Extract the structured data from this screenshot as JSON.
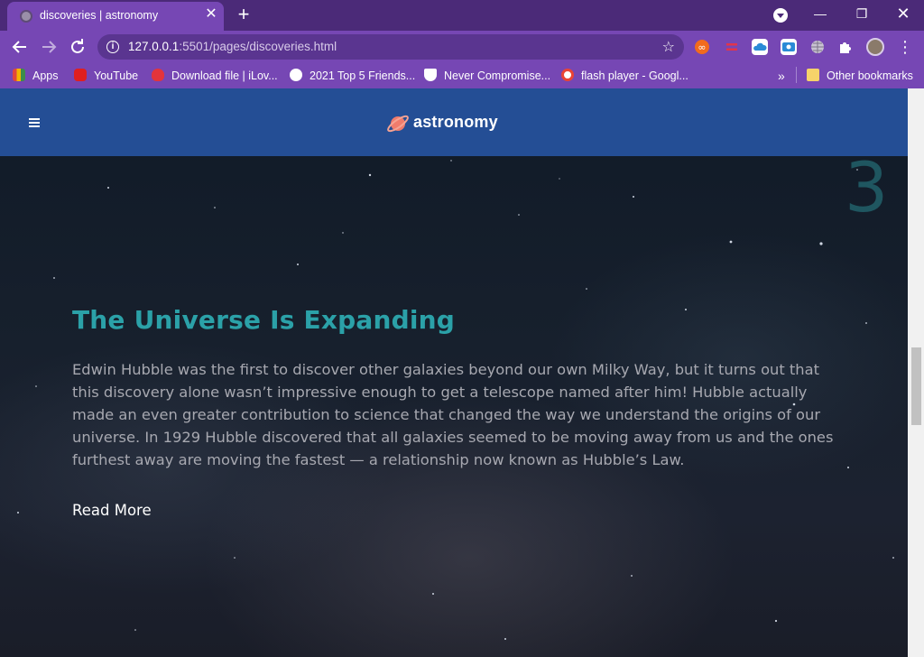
{
  "browser": {
    "tab_title": "discoveries | astronomy",
    "tab_close": "✕",
    "new_tab": "+",
    "url_host": "127.0.0.1",
    "url_path": ":5501/pages/discoveries.html",
    "window_controls": {
      "minimize": "—",
      "maximize": "❐",
      "close": "✕"
    }
  },
  "bookmarks": [
    {
      "label": "Apps",
      "icon": "apps-grid-icon",
      "color": "#e2463b"
    },
    {
      "label": "YouTube",
      "icon": "youtube-icon",
      "color": "#e01f1f"
    },
    {
      "label": "Download file | iLov...",
      "icon": "heart-icon",
      "color": "#e3343b"
    },
    {
      "label": "2021 Top 5 Friends...",
      "icon": "globe-icon",
      "color": "#ffffff"
    },
    {
      "label": "Never Compromise...",
      "icon": "shield-icon",
      "color": "#ffffff"
    },
    {
      "label": "flash player - Googl...",
      "icon": "google-icon",
      "color": "#ffffff"
    }
  ],
  "bookmarks_overflow": "»",
  "other_bookmarks": "Other bookmarks",
  "site": {
    "logo_text": "astronomy",
    "slide_number": "3",
    "title": "The Universe Is Expanding",
    "body": "Edwin Hubble was the first to discover other galaxies beyond our own Milky Way, but it turns out that this discovery alone wasn’t impressive enough to get a telescope named after him! Hubble actually made an even greater contribution to science that changed the way we understand the origins of our universe. In 1929 Hubble discovered that all galaxies seemed to be moving away from us and the ones furthest away are moving the fastest — a relationship now known as Hubble’s Law.",
    "read_more": "Read More"
  },
  "colors": {
    "header_blue": "#244e95",
    "title_teal": "#2ba1a8",
    "chrome_purple": "#7647b4"
  }
}
